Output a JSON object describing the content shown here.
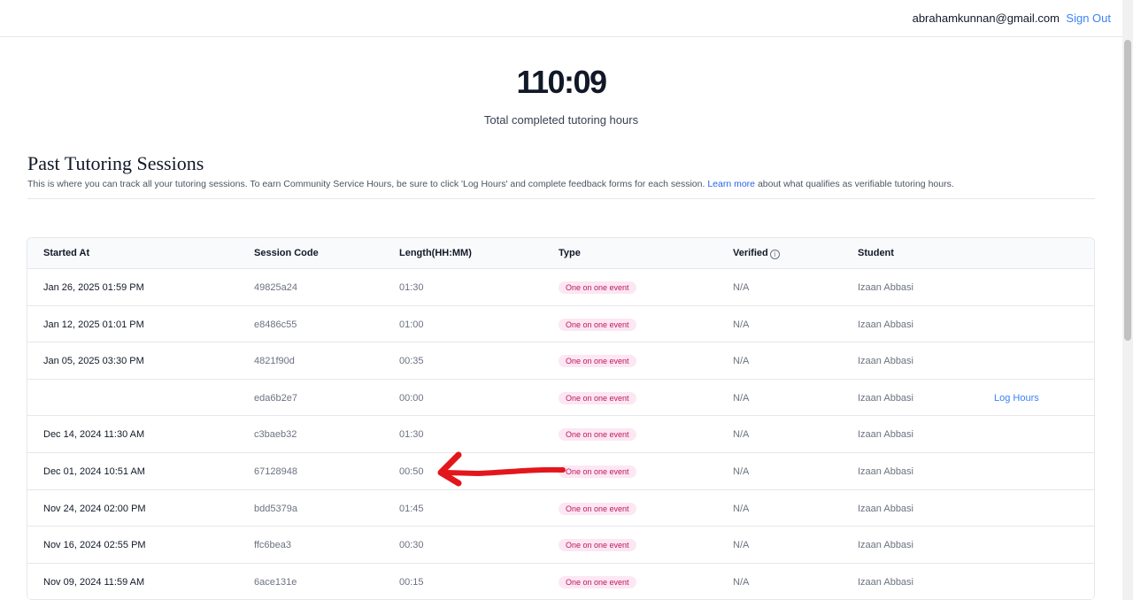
{
  "header": {
    "email": "abrahamkunnan@gmail.com",
    "sign_out": "Sign Out"
  },
  "summary": {
    "total_hours": "110:09",
    "label": "Total completed tutoring hours"
  },
  "section": {
    "title": "Past Tutoring Sessions",
    "desc_before": "This is where you can track all your tutoring sessions. To earn Community Service Hours, be sure to click 'Log Hours' and complete feedback forms for each session. ",
    "learn_more": "Learn more",
    "desc_after": " about what qualifies as verifiable tutoring hours."
  },
  "table": {
    "headers": {
      "started_at": "Started At",
      "session_code": "Session Code",
      "length": "Length(HH:MM)",
      "type": "Type",
      "verified": "Verified",
      "student": "Student"
    },
    "info_icon": "info-icon",
    "rows": [
      {
        "started": "Jan 26, 2025 01:59 PM",
        "code": "49825a24",
        "length": "01:30",
        "type": "One on one event",
        "verified": "N/A",
        "student": "Izaan Abbasi",
        "action": ""
      },
      {
        "started": "Jan 12, 2025 01:01 PM",
        "code": "e8486c55",
        "length": "01:00",
        "type": "One on one event",
        "verified": "N/A",
        "student": "Izaan Abbasi",
        "action": ""
      },
      {
        "started": "Jan 05, 2025 03:30 PM",
        "code": "4821f90d",
        "length": "00:35",
        "type": "One on one event",
        "verified": "N/A",
        "student": "Izaan Abbasi",
        "action": ""
      },
      {
        "started": "",
        "code": "eda6b2e7",
        "length": "00:00",
        "type": "One on one event",
        "verified": "N/A",
        "student": "Izaan Abbasi",
        "action": "Log Hours"
      },
      {
        "started": "Dec 14, 2024 11:30 AM",
        "code": "c3baeb32",
        "length": "01:30",
        "type": "One on one event",
        "verified": "N/A",
        "student": "Izaan Abbasi",
        "action": ""
      },
      {
        "started": "Dec 01, 2024 10:51 AM",
        "code": "67128948",
        "length": "00:50",
        "type": "One on one event",
        "verified": "N/A",
        "student": "Izaan Abbasi",
        "action": ""
      },
      {
        "started": "Nov 24, 2024 02:00 PM",
        "code": "bdd5379a",
        "length": "01:45",
        "type": "One on one event",
        "verified": "N/A",
        "student": "Izaan Abbasi",
        "action": ""
      },
      {
        "started": "Nov 16, 2024 02:55 PM",
        "code": "ffc6bea3",
        "length": "00:30",
        "type": "One on one event",
        "verified": "N/A",
        "student": "Izaan Abbasi",
        "action": ""
      },
      {
        "started": "Nov 09, 2024 11:59 AM",
        "code": "6ace131e",
        "length": "00:15",
        "type": "One on one event",
        "verified": "N/A",
        "student": "Izaan Abbasi",
        "action": ""
      }
    ]
  },
  "colors": {
    "accent": "#3b82f6",
    "badge_bg": "#fce7f3",
    "badge_text": "#be185d",
    "annotation": "#e3161c"
  }
}
